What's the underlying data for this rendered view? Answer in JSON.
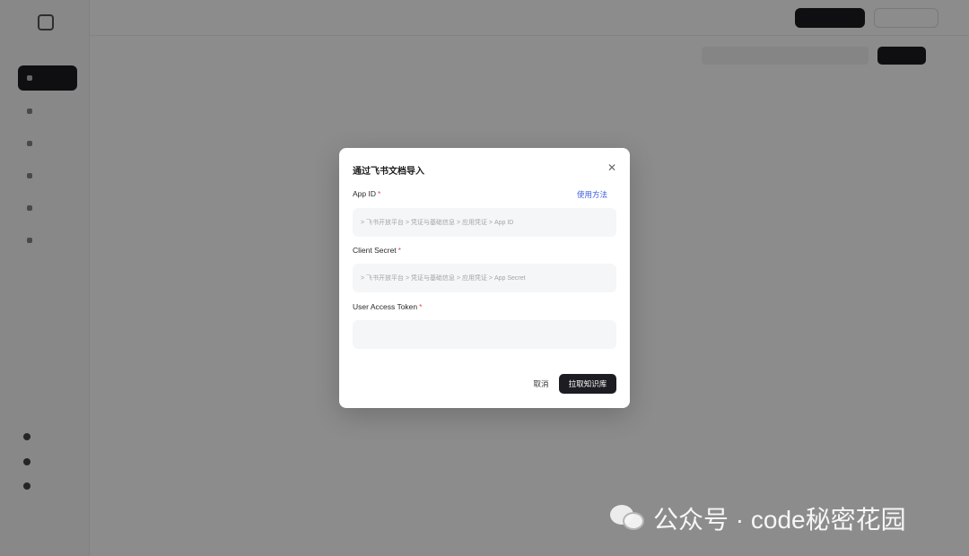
{
  "modal": {
    "title": "通过飞书文档导入",
    "close_icon": "close-icon",
    "help_link": "使用方法",
    "fields": [
      {
        "label": "App ID",
        "required_mark": "*",
        "value": "",
        "placeholder": "> 飞书开放平台 > 凭证与基础信息 > 应用凭证 > App ID"
      },
      {
        "label": "Client Secret",
        "required_mark": "*",
        "value": "",
        "placeholder": "> 飞书开放平台 > 凭证与基础信息 > 应用凭证 > App Secret"
      },
      {
        "label": "User Access Token",
        "required_mark": "*",
        "value": "",
        "placeholder": ""
      }
    ],
    "cancel_label": "取消",
    "submit_label": "拉取知识库"
  },
  "watermark": {
    "text": "公众号 · code秘密花园",
    "icon": "wechat-icon"
  },
  "colors": {
    "overlay": "rgba(0,0,0,0.45)",
    "primary": "#1c1c22",
    "link": "#3b5bdb",
    "required": "#e5484d",
    "input_bg": "#f5f6f7"
  }
}
